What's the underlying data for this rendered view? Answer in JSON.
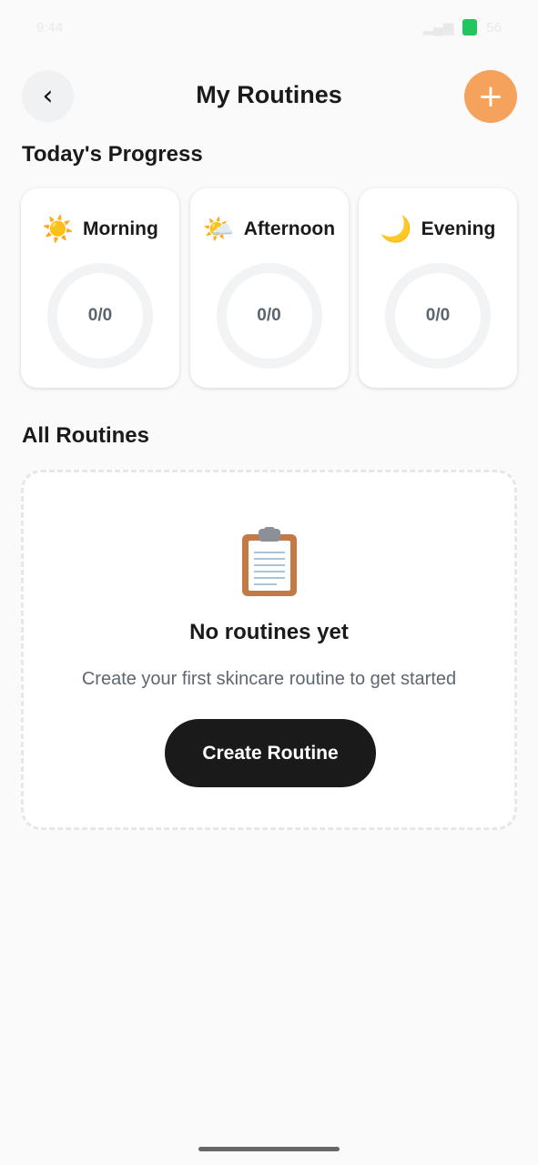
{
  "status_bar": {
    "time": "9:44",
    "battery": "56"
  },
  "header": {
    "back_icon": "‹",
    "title": "My Routines",
    "add_icon": "+"
  },
  "progress": {
    "section_title": "Today's Progress",
    "cards": [
      {
        "icon": "☀️",
        "icon_name": "sun-icon",
        "label": "Morning",
        "count": "0/0"
      },
      {
        "icon": "🌤️",
        "icon_name": "sun-cloud-icon",
        "label": "Afternoon",
        "count": "0/0"
      },
      {
        "icon": "🌙",
        "icon_name": "moon-icon",
        "label": "Evening",
        "count": "0/0"
      }
    ]
  },
  "routines": {
    "section_title": "All Routines",
    "empty_title": "No routines yet",
    "empty_text": "Create your first skincare routine to get started",
    "create_label": "Create Routine"
  },
  "colors": {
    "accent": "#f5a25d",
    "primary_button": "#1a1a1a",
    "ring_track": "#f1f3f5"
  }
}
